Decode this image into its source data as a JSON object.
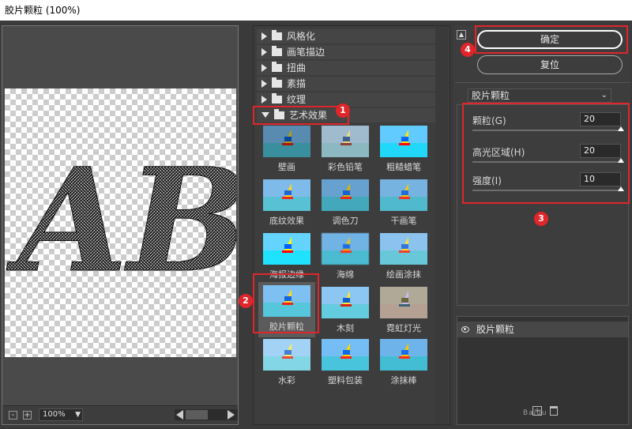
{
  "window": {
    "title": "胶片颗粒 (100%)"
  },
  "preview": {
    "canvas_text": "AB",
    "zoom": "100%",
    "zoom_out": "-",
    "zoom_in": "+"
  },
  "gallery": {
    "categories": [
      {
        "label": "风格化",
        "expanded": false
      },
      {
        "label": "画笔描边",
        "expanded": false
      },
      {
        "label": "扭曲",
        "expanded": false
      },
      {
        "label": "素描",
        "expanded": false
      },
      {
        "label": "纹理",
        "expanded": false
      },
      {
        "label": "艺术效果",
        "expanded": true
      }
    ],
    "filters": [
      "壁画",
      "彩色铅笔",
      "粗糙蜡笔",
      "底纹效果",
      "调色刀",
      "干画笔",
      "海报边缘",
      "海绵",
      "绘画涂抹",
      "胶片颗粒",
      "木刻",
      "霓虹灯光",
      "水彩",
      "塑料包装",
      "涂抹棒"
    ],
    "selected_filter": "胶片颗粒"
  },
  "actions": {
    "ok": "确定",
    "reset": "复位"
  },
  "settings": {
    "filter_select": "胶片颗粒",
    "params": [
      {
        "label": "颗粒(G)",
        "value": "20",
        "fraction": 1.0
      },
      {
        "label": "高光区域(H)",
        "value": "20",
        "fraction": 1.0
      },
      {
        "label": "强度(I)",
        "value": "10",
        "fraction": 1.0
      }
    ]
  },
  "layers": {
    "items": [
      {
        "name": "胶片颗粒"
      }
    ]
  },
  "annotations": {
    "badges": [
      "1",
      "2",
      "3",
      "4"
    ],
    "color": "#e0262a"
  },
  "watermark": "Baidu"
}
